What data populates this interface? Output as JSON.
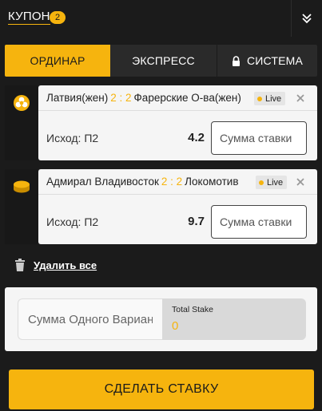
{
  "header": {
    "title": "КУПОН",
    "count": "2",
    "collapse_icon": "double-chevron-down-icon"
  },
  "tabs": [
    {
      "label": "ОРДИНАР",
      "active": true
    },
    {
      "label": "ЭКСПРЕСС",
      "active": false
    },
    {
      "label": "СИСТЕМА",
      "active": false,
      "icon": "lock-icon"
    }
  ],
  "bets": [
    {
      "sport_icon": "volleyball-icon",
      "team1": "Латвия(жен)",
      "score": "2 : 2",
      "team2": "Фарерские О-ва(жен)",
      "live_label": "Live",
      "outcome_label": "Исход:",
      "outcome_value": "П2",
      "odds": "4.2",
      "stake_placeholder": "Сумма ставки"
    },
    {
      "sport_icon": "hockey-puck-icon",
      "team1": "Адмирал Владивосток",
      "score": "2 : 2",
      "team2": "Локомотив",
      "live_label": "Live",
      "outcome_label": "Исход:",
      "outcome_value": "П2",
      "odds": "9.7",
      "stake_placeholder": "Сумма ставки"
    }
  ],
  "delete_all": {
    "label": "Удалить все",
    "icon": "trash-icon"
  },
  "stake_box": {
    "single_placeholder": "Сумма Одного Варианта",
    "total_label": "Total Stake",
    "total_value": "0"
  },
  "place_bet": {
    "label": "СДЕЛАТЬ СТАВКУ"
  },
  "colors": {
    "accent": "#f6b40e",
    "background": "#1b1b1b",
    "card": "#f5f5f5"
  }
}
